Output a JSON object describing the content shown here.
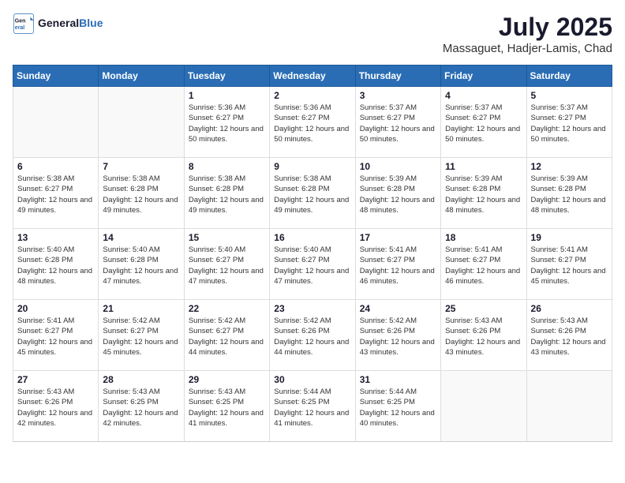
{
  "logo": {
    "text_general": "General",
    "text_blue": "Blue"
  },
  "header": {
    "month_year": "July 2025",
    "location": "Massaguet, Hadjer-Lamis, Chad"
  },
  "weekdays": [
    "Sunday",
    "Monday",
    "Tuesday",
    "Wednesday",
    "Thursday",
    "Friday",
    "Saturday"
  ],
  "weeks": [
    [
      {
        "day": "",
        "info": ""
      },
      {
        "day": "",
        "info": ""
      },
      {
        "day": "1",
        "info": "Sunrise: 5:36 AM\nSunset: 6:27 PM\nDaylight: 12 hours and 50 minutes."
      },
      {
        "day": "2",
        "info": "Sunrise: 5:36 AM\nSunset: 6:27 PM\nDaylight: 12 hours and 50 minutes."
      },
      {
        "day": "3",
        "info": "Sunrise: 5:37 AM\nSunset: 6:27 PM\nDaylight: 12 hours and 50 minutes."
      },
      {
        "day": "4",
        "info": "Sunrise: 5:37 AM\nSunset: 6:27 PM\nDaylight: 12 hours and 50 minutes."
      },
      {
        "day": "5",
        "info": "Sunrise: 5:37 AM\nSunset: 6:27 PM\nDaylight: 12 hours and 50 minutes."
      }
    ],
    [
      {
        "day": "6",
        "info": "Sunrise: 5:38 AM\nSunset: 6:27 PM\nDaylight: 12 hours and 49 minutes."
      },
      {
        "day": "7",
        "info": "Sunrise: 5:38 AM\nSunset: 6:28 PM\nDaylight: 12 hours and 49 minutes."
      },
      {
        "day": "8",
        "info": "Sunrise: 5:38 AM\nSunset: 6:28 PM\nDaylight: 12 hours and 49 minutes."
      },
      {
        "day": "9",
        "info": "Sunrise: 5:38 AM\nSunset: 6:28 PM\nDaylight: 12 hours and 49 minutes."
      },
      {
        "day": "10",
        "info": "Sunrise: 5:39 AM\nSunset: 6:28 PM\nDaylight: 12 hours and 48 minutes."
      },
      {
        "day": "11",
        "info": "Sunrise: 5:39 AM\nSunset: 6:28 PM\nDaylight: 12 hours and 48 minutes."
      },
      {
        "day": "12",
        "info": "Sunrise: 5:39 AM\nSunset: 6:28 PM\nDaylight: 12 hours and 48 minutes."
      }
    ],
    [
      {
        "day": "13",
        "info": "Sunrise: 5:40 AM\nSunset: 6:28 PM\nDaylight: 12 hours and 48 minutes."
      },
      {
        "day": "14",
        "info": "Sunrise: 5:40 AM\nSunset: 6:28 PM\nDaylight: 12 hours and 47 minutes."
      },
      {
        "day": "15",
        "info": "Sunrise: 5:40 AM\nSunset: 6:27 PM\nDaylight: 12 hours and 47 minutes."
      },
      {
        "day": "16",
        "info": "Sunrise: 5:40 AM\nSunset: 6:27 PM\nDaylight: 12 hours and 47 minutes."
      },
      {
        "day": "17",
        "info": "Sunrise: 5:41 AM\nSunset: 6:27 PM\nDaylight: 12 hours and 46 minutes."
      },
      {
        "day": "18",
        "info": "Sunrise: 5:41 AM\nSunset: 6:27 PM\nDaylight: 12 hours and 46 minutes."
      },
      {
        "day": "19",
        "info": "Sunrise: 5:41 AM\nSunset: 6:27 PM\nDaylight: 12 hours and 45 minutes."
      }
    ],
    [
      {
        "day": "20",
        "info": "Sunrise: 5:41 AM\nSunset: 6:27 PM\nDaylight: 12 hours and 45 minutes."
      },
      {
        "day": "21",
        "info": "Sunrise: 5:42 AM\nSunset: 6:27 PM\nDaylight: 12 hours and 45 minutes."
      },
      {
        "day": "22",
        "info": "Sunrise: 5:42 AM\nSunset: 6:27 PM\nDaylight: 12 hours and 44 minutes."
      },
      {
        "day": "23",
        "info": "Sunrise: 5:42 AM\nSunset: 6:26 PM\nDaylight: 12 hours and 44 minutes."
      },
      {
        "day": "24",
        "info": "Sunrise: 5:42 AM\nSunset: 6:26 PM\nDaylight: 12 hours and 43 minutes."
      },
      {
        "day": "25",
        "info": "Sunrise: 5:43 AM\nSunset: 6:26 PM\nDaylight: 12 hours and 43 minutes."
      },
      {
        "day": "26",
        "info": "Sunrise: 5:43 AM\nSunset: 6:26 PM\nDaylight: 12 hours and 43 minutes."
      }
    ],
    [
      {
        "day": "27",
        "info": "Sunrise: 5:43 AM\nSunset: 6:26 PM\nDaylight: 12 hours and 42 minutes."
      },
      {
        "day": "28",
        "info": "Sunrise: 5:43 AM\nSunset: 6:25 PM\nDaylight: 12 hours and 42 minutes."
      },
      {
        "day": "29",
        "info": "Sunrise: 5:43 AM\nSunset: 6:25 PM\nDaylight: 12 hours and 41 minutes."
      },
      {
        "day": "30",
        "info": "Sunrise: 5:44 AM\nSunset: 6:25 PM\nDaylight: 12 hours and 41 minutes."
      },
      {
        "day": "31",
        "info": "Sunrise: 5:44 AM\nSunset: 6:25 PM\nDaylight: 12 hours and 40 minutes."
      },
      {
        "day": "",
        "info": ""
      },
      {
        "day": "",
        "info": ""
      }
    ]
  ]
}
